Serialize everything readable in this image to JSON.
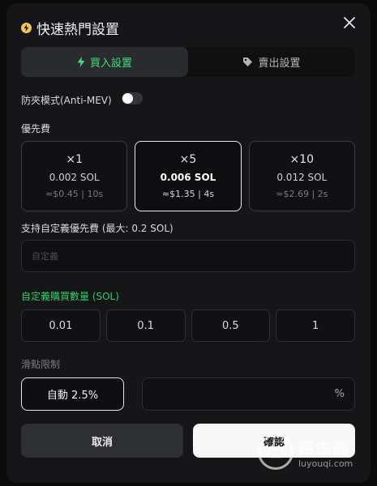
{
  "header": {
    "title": "快速熱門設置",
    "icon": "bolt-icon",
    "close_icon": "close-icon"
  },
  "tabs": [
    {
      "label": "買入設置",
      "icon": "bolt-icon",
      "active": true
    },
    {
      "label": "賣出設置",
      "icon": "tag-icon",
      "active": false
    }
  ],
  "anti_mev": {
    "label": "防夾模式(Anti-MEV)",
    "enabled": false
  },
  "priority_fee": {
    "label": "優先費",
    "options": [
      {
        "multiplier": "×1",
        "sol": "0.002 SOL",
        "estimate": "≈$0.45 | 10s",
        "selected": false
      },
      {
        "multiplier": "×5",
        "sol": "0.006 SOL",
        "estimate": "≈$1.35 | 4s",
        "selected": true
      },
      {
        "multiplier": "×10",
        "sol": "0.012 SOL",
        "estimate": "≈$2.69 | 2s",
        "selected": false
      }
    ]
  },
  "custom_fee": {
    "label": "支持自定義優先費 (最大: 0.2 SOL)",
    "placeholder": "自定義",
    "value": ""
  },
  "buy_amount": {
    "label": "自定義購買數量 (SOL)",
    "options": [
      "0.01",
      "0.1",
      "0.5",
      "1"
    ]
  },
  "slippage": {
    "label": "滑點限制",
    "auto_label": "自動 2.5%",
    "value": "",
    "unit": "%"
  },
  "actions": {
    "cancel": "取消",
    "confirm": "確認"
  },
  "watermark": {
    "name": "路由器",
    "url": "luyouqi.com"
  },
  "colors": {
    "accent_green": "#2fcf6a",
    "bolt_yellow": "#f2c94c",
    "background": "#161618"
  }
}
